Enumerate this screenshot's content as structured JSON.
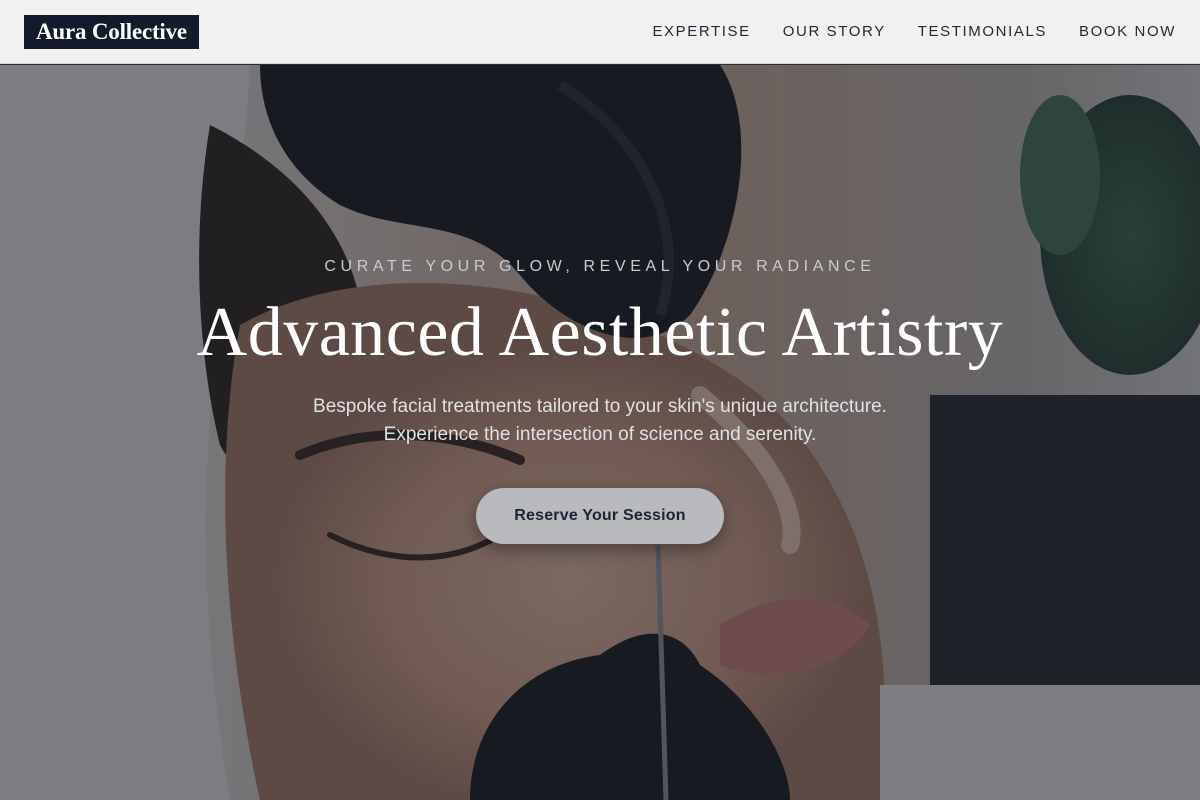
{
  "brand": {
    "name": "Aura Collective"
  },
  "nav": {
    "items": [
      {
        "label": "EXPERTISE"
      },
      {
        "label": "OUR STORY"
      },
      {
        "label": "TESTIMONIALS"
      },
      {
        "label": "BOOK NOW"
      }
    ]
  },
  "hero": {
    "eyebrow": "CURATE YOUR GLOW, REVEAL YOUR RADIANCE",
    "title": "Advanced Aesthetic Artistry",
    "subtitle_line1": "Bespoke facial treatments tailored to your skin's unique architecture.",
    "subtitle_line2": "Experience the intersection of science and serenity.",
    "cta_label": "Reserve Your Session",
    "background_image": "photo of a facial treatment with gloved hands"
  },
  "colors": {
    "brand_dark": "#121a2b",
    "header_bg": "#f1f1f2",
    "cta_bg": "#b9babd"
  }
}
